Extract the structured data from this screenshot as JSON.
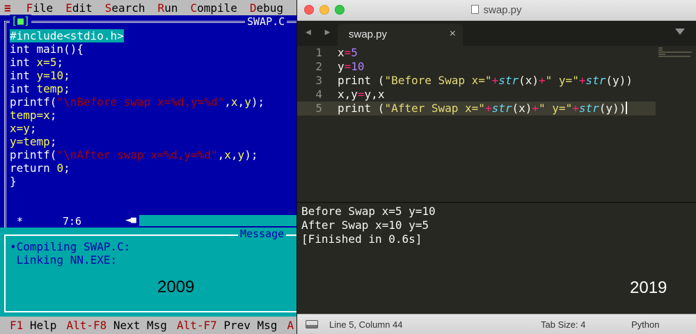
{
  "turbo_c": {
    "menu": {
      "system_glyph": "≡",
      "items": [
        {
          "hotkey": "F",
          "rest": "ile"
        },
        {
          "hotkey": "E",
          "rest": "dit"
        },
        {
          "hotkey": "S",
          "rest": "earch"
        },
        {
          "hotkey": "R",
          "rest": "un"
        },
        {
          "hotkey": "C",
          "rest": "ompile"
        },
        {
          "hotkey": "D",
          "rest": "ebug"
        }
      ]
    },
    "window": {
      "close_box": "[■]",
      "filename": "SWAP.C",
      "cursor_position": "7:6",
      "status_star": "*",
      "scroll_thumb": "◄■"
    },
    "code": {
      "line1": "#include<stdio.h>",
      "line2": "int main(){",
      "line3_a": "int ",
      "line3_b": "x",
      "line3_c": "=",
      "line3_d": "5",
      "line3_e": ";",
      "line4_a": "int ",
      "line4_b": "y",
      "line4_c": "=",
      "line4_d": "10",
      "line4_e": ";",
      "line5_a": "int ",
      "line5_b": "temp",
      "line5_c": ";",
      "line6_a": "printf(",
      "line6_b": "\"\\nBefore swap x=%d,y=%d\"",
      "line6_c": ",",
      "line6_d": "x",
      "line6_e": ",",
      "line6_f": "y",
      "line6_g": ");",
      "line7_a": "temp",
      "line7_b": "=",
      "line7_c": "x",
      "line7_d": ";",
      "line8_a": "x",
      "line8_b": "=",
      "line8_c": "y",
      "line8_d": ";",
      "line9_a": "y",
      "line9_b": "=",
      "line9_c": "temp",
      "line9_d": ";",
      "line10_a": "printf(",
      "line10_b": "\"\\nAfter swap x=%d,y=%d\"",
      "line10_c": ",",
      "line10_d": "x",
      "line10_e": ",",
      "line10_f": "y",
      "line10_g": ");",
      "line11_a": "return ",
      "line11_b": "0",
      "line11_c": ";",
      "line12": "}"
    },
    "message": {
      "title": "Message",
      "line1": "•Compiling SWAP.C:",
      "line2": " Linking NN.EXE:"
    },
    "year_label": "2009",
    "function_keys": [
      {
        "key": "F1",
        "label": " Help"
      },
      {
        "key": "Alt-F8",
        "label": " Next Msg"
      },
      {
        "key": "Alt-F7",
        "label": " Prev Msg"
      },
      {
        "key": "A",
        "label": ""
      }
    ]
  },
  "sublime": {
    "window_title": "swap.py",
    "nav_arrows": "◀ ▶",
    "tab_label": "swap.py",
    "tab_close": "×",
    "line_numbers": [
      "1",
      "2",
      "3",
      "4",
      "5"
    ],
    "code": {
      "l1_a": "x",
      "l1_b": "=",
      "l1_c": "5",
      "l2_a": "y",
      "l2_b": "=",
      "l2_c": "10",
      "l3_a": "print (",
      "l3_b": "\"Before Swap x=\"",
      "l3_c": "+",
      "l3_d": "str",
      "l3_e": "(x)",
      "l3_f": "+",
      "l3_g": "\" y=\"",
      "l3_h": "+",
      "l3_i": "str",
      "l3_j": "(y))",
      "l4_a": "x,y",
      "l4_b": "=",
      "l4_c": "y,x",
      "l5_a": "print (",
      "l5_b": "\"After Swap x=\"",
      "l5_c": "+",
      "l5_d": "str",
      "l5_e": "(x)",
      "l5_f": "+",
      "l5_g": "\" y=\"",
      "l5_h": "+",
      "l5_i": "str",
      "l5_j": "(y))"
    },
    "output": {
      "line1": "Before Swap x=5 y=10",
      "line2": "After Swap x=10 y=5",
      "line3": "[Finished in 0.6s]"
    },
    "year_label": "2019",
    "status": {
      "position": "Line 5, Column 44",
      "tab_size": "Tab Size: 4",
      "syntax": "Python"
    }
  }
}
